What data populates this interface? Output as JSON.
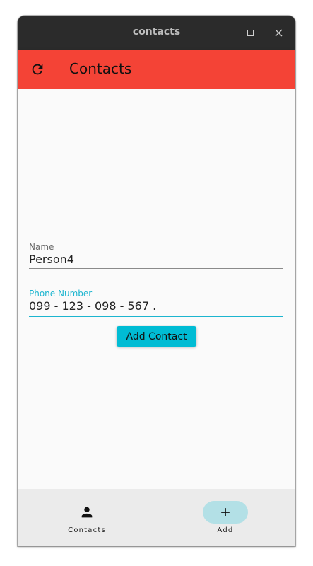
{
  "window": {
    "title": "contacts"
  },
  "appbar": {
    "title": "Contacts",
    "refresh_icon": "refresh-icon",
    "color": "#f44336"
  },
  "form": {
    "name_label": "Name",
    "name_value": "Person4",
    "phone_label": "Phone Number",
    "phone_value": "099 - 123 - 098 - 567 .",
    "add_button_label": "Add Contact",
    "accent_color": "#00bcd4"
  },
  "bottom_nav": {
    "items": [
      {
        "label": "Contacts",
        "icon": "person-icon",
        "selected": false
      },
      {
        "label": "Add",
        "icon": "plus-icon",
        "selected": true
      }
    ]
  }
}
